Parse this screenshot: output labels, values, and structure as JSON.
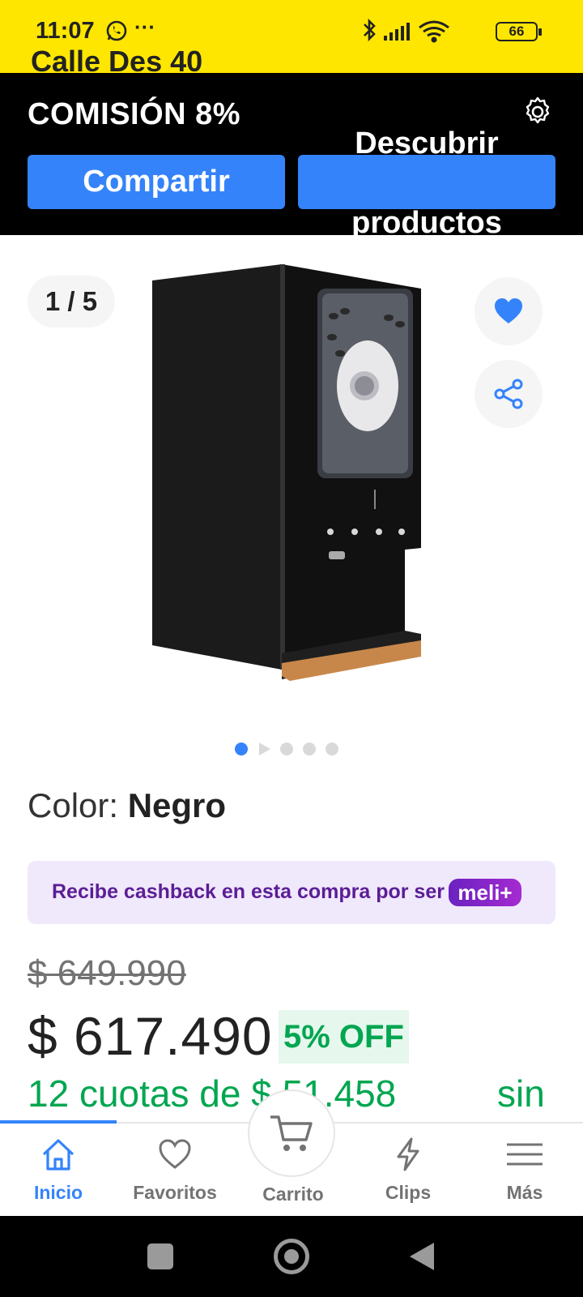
{
  "status_bar": {
    "time": "11:07",
    "battery": "66",
    "cut_text": "Calle Des 40",
    "icons": [
      "whatsapp-icon",
      "more-dots-icon",
      "bluetooth-icon",
      "signal-icon",
      "wifi-icon",
      "battery-icon"
    ]
  },
  "affiliate_bar": {
    "commission": "COMISIÓN 8%",
    "share_label": "Compartir",
    "discover_line1": "Descubrir",
    "discover_line2": "productos"
  },
  "gallery": {
    "counter": "1 / 5",
    "image_count": 5,
    "active_index": 0
  },
  "product": {
    "color_label": "Color: ",
    "color_value": "Negro",
    "cashback_text": "Recibe cashback en esta compra por ser",
    "meli_badge": "meli+",
    "old_price": "$ 649.990",
    "price": "$ 617.490",
    "discount": "5% OFF",
    "installments": "12 cuotas de $ 51.458",
    "installments_suffix": "sin"
  },
  "tab_bar": {
    "tabs": [
      {
        "label": "Inicio",
        "icon": "home-icon",
        "active": true
      },
      {
        "label": "Favoritos",
        "icon": "heart-outline-icon",
        "active": false
      },
      {
        "label": "Carrito",
        "icon": "cart-icon",
        "active": false
      },
      {
        "label": "Clips",
        "icon": "lightning-icon",
        "active": false
      },
      {
        "label": "Más",
        "icon": "menu-icon",
        "active": false
      }
    ]
  },
  "colors": {
    "brand_yellow": "#ffe600",
    "accent_blue": "#3483fa",
    "discount_green": "#00a650",
    "meli_purple": "#5b1e96"
  }
}
